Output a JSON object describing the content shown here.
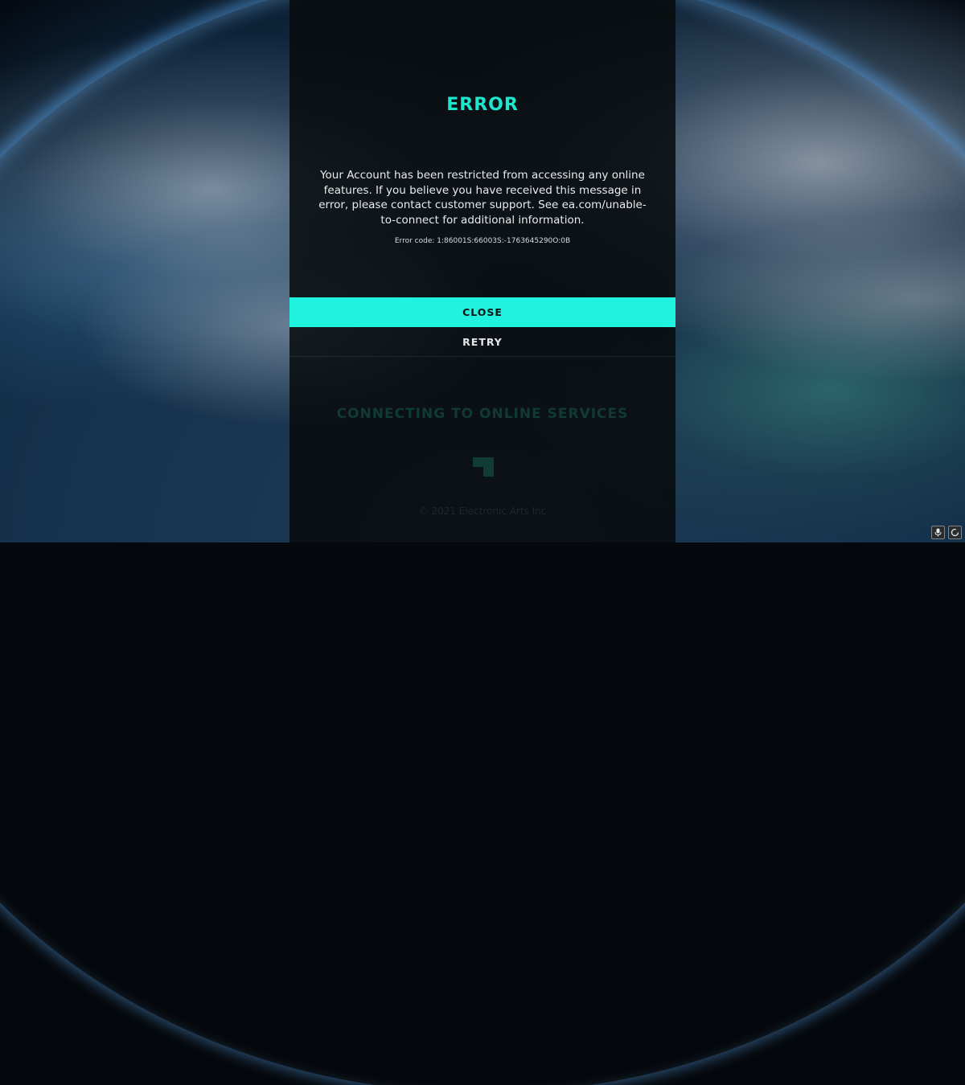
{
  "dialog": {
    "title": "ERROR",
    "message": "Your Account has been restricted from accessing any online features. If you believe you have received this message in error, please contact customer support. See ea.com/unable-to-connect for additional information.",
    "error_code": "Error code: 1:86001S:66003S:-1763645290O:0B",
    "close_label": "CLOSE",
    "retry_label": "RETRY"
  },
  "loading": {
    "status": "CONNECTING TO ONLINE SERVICES",
    "copyright": "© 2021 Electronic Arts Inc"
  },
  "system_tray": {
    "icons": [
      "microphone-icon",
      "loading-circle-icon"
    ]
  },
  "colors": {
    "accent": "#1ff2df",
    "title": "#1de6cf",
    "overlay": "#08090b"
  }
}
